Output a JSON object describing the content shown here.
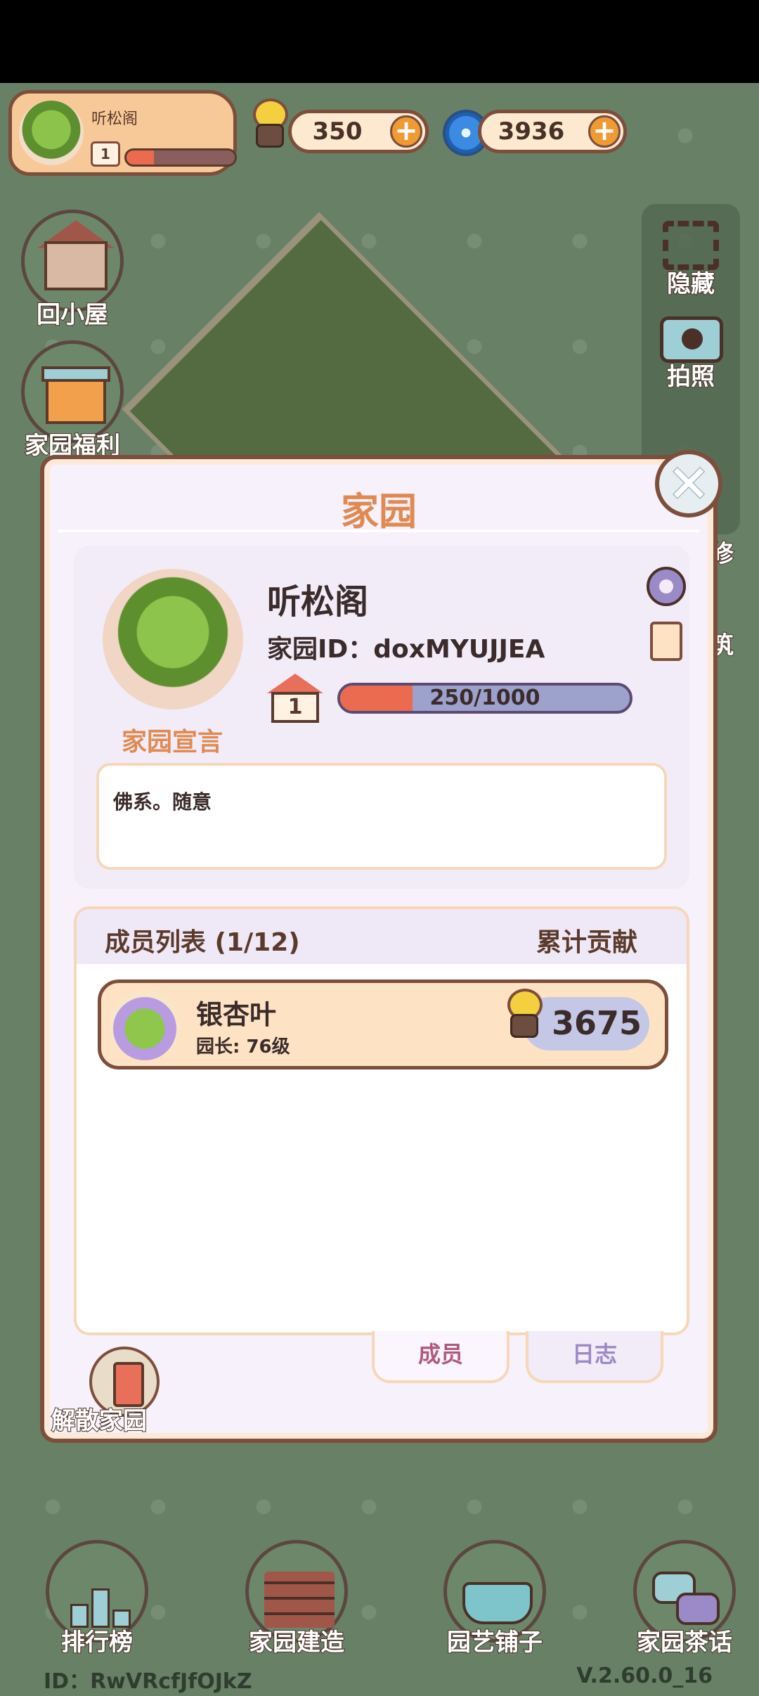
{
  "hud": {
    "home_name": "听松阁",
    "home_level": "1",
    "home_progress": 0.25,
    "snail_coins": "350",
    "swirl_gems": "3936",
    "plus": "+"
  },
  "left_buttons": {
    "back_home": "回小屋",
    "welfare": "家园福利"
  },
  "right_tools": {
    "hide": "隐藏",
    "photo": "拍照",
    "decorate_partial": "修",
    "build_partial": "筑"
  },
  "dialog": {
    "title": "家园",
    "close": "✕",
    "home_name": "听松阁",
    "home_id": "家园ID：doxMYUJJEA",
    "level": "1",
    "exp_text": "250/1000",
    "exp_fraction": 0.25,
    "manifesto_label": "家园宣言",
    "manifesto_text": "佛系。随意",
    "members_title": "成员列表 (1/12)",
    "contribution_label": "累计贡献",
    "members": [
      {
        "name": "银杏叶",
        "role": "园长: 76级",
        "contribution": "3675"
      }
    ],
    "tabs": [
      {
        "label": "成员",
        "active": true
      },
      {
        "label": "日志",
        "active": false
      }
    ],
    "dissolve": "解散家园"
  },
  "bottom_nav": [
    {
      "label": "排行榜",
      "icon": "ranking-podium-icon"
    },
    {
      "label": "家园建造",
      "icon": "bricks-trowel-icon"
    },
    {
      "label": "园艺铺子",
      "icon": "flower-basin-icon"
    },
    {
      "label": "家园茶话",
      "icon": "chat-bubbles-icon"
    }
  ],
  "footer": {
    "player_id": "ID：RwVRcfJfOJkZ",
    "version": "V.2.60.0_16"
  },
  "colors": {
    "accent_orange": "#e08a52",
    "outline_brown": "#7d4e3c",
    "exp_fill": "#ea6b4f"
  }
}
